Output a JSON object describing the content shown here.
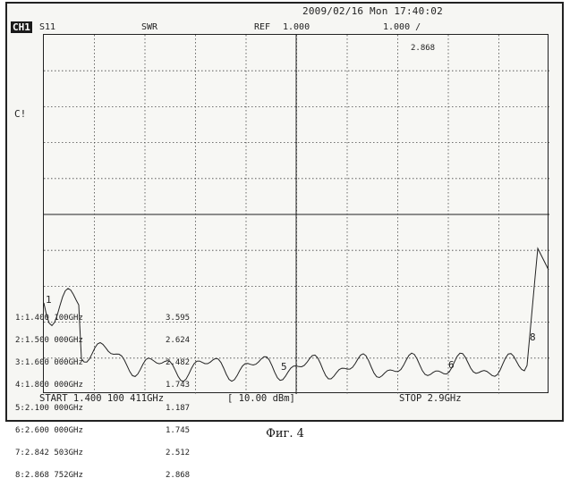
{
  "header": {
    "datetime": "2009/02/16 Mon 17:40:02",
    "channel": "CH1",
    "parameter": "S11",
    "format": "SWR",
    "ref_label": "REF",
    "ref_value": "1.000",
    "scale": "1.000 /",
    "marker_readout": "2.868"
  },
  "side_label": "C!",
  "markers": [
    {
      "label": "1:1.400 100GHz",
      "value": "3.595"
    },
    {
      "label": "2:1.500 000GHz",
      "value": "2.624"
    },
    {
      "label": "3:1.600 000GHz",
      "value": "2.482"
    },
    {
      "label": "4:1.800 000GHz",
      "value": "1.743"
    },
    {
      "label": "5:2.100 000GHz",
      "value": "1.187"
    },
    {
      "label": "6:2.600 000GHz",
      "value": "1.745"
    },
    {
      "label": "7:2.842 503GHz",
      "value": "2.512"
    },
    {
      "label": "8:2.868 752GHz",
      "value": "2.868"
    }
  ],
  "trace_tags": {
    "m1": "1",
    "m5": "5",
    "m6": "6",
    "m8": "8"
  },
  "footer": {
    "start": "START 1.400 100 411GHz",
    "power": "[ 10.00 dBm]",
    "stop": "STOP 2.9GHz"
  },
  "caption": "Фиг. 4"
}
